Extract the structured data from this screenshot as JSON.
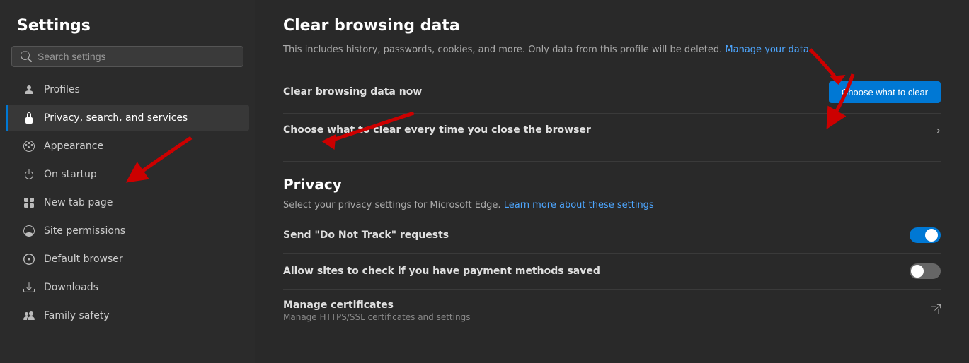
{
  "sidebar": {
    "title": "Settings",
    "search_placeholder": "Search settings",
    "items": [
      {
        "id": "profiles",
        "label": "Profiles",
        "icon": "person"
      },
      {
        "id": "privacy",
        "label": "Privacy, search, and services",
        "icon": "lock",
        "active": true
      },
      {
        "id": "appearance",
        "label": "Appearance",
        "icon": "appearance"
      },
      {
        "id": "startup",
        "label": "On startup",
        "icon": "power"
      },
      {
        "id": "newtab",
        "label": "New tab page",
        "icon": "newtab"
      },
      {
        "id": "permissions",
        "label": "Site permissions",
        "icon": "permissions"
      },
      {
        "id": "defaultbrowser",
        "label": "Default browser",
        "icon": "browser"
      },
      {
        "id": "downloads",
        "label": "Downloads",
        "icon": "download"
      },
      {
        "id": "family",
        "label": "Family safety",
        "icon": "family"
      }
    ]
  },
  "main": {
    "clear_browsing": {
      "title": "Clear browsing data",
      "description": "This includes history, passwords, cookies, and more. Only data from this profile will be deleted.",
      "manage_link": "Manage your data",
      "now_label": "Clear browsing data now",
      "choose_button": "Choose what to clear",
      "every_close_label": "Choose what to clear every time you close the browser"
    },
    "privacy": {
      "title": "Privacy",
      "description": "Select your privacy settings for Microsoft Edge.",
      "learn_link": "Learn more about these settings",
      "rows": [
        {
          "id": "dnt",
          "label": "Send \"Do Not Track\" requests",
          "sublabel": "",
          "toggle": true,
          "toggle_on": true,
          "chevron": false,
          "ext": false
        },
        {
          "id": "payment",
          "label": "Allow sites to check if you have payment methods saved",
          "sublabel": "",
          "toggle": true,
          "toggle_on": false,
          "chevron": false,
          "ext": false
        },
        {
          "id": "certificates",
          "label": "Manage certificates",
          "sublabel": "Manage HTTPS/SSL certificates and settings",
          "toggle": false,
          "toggle_on": false,
          "chevron": false,
          "ext": true
        }
      ]
    }
  }
}
